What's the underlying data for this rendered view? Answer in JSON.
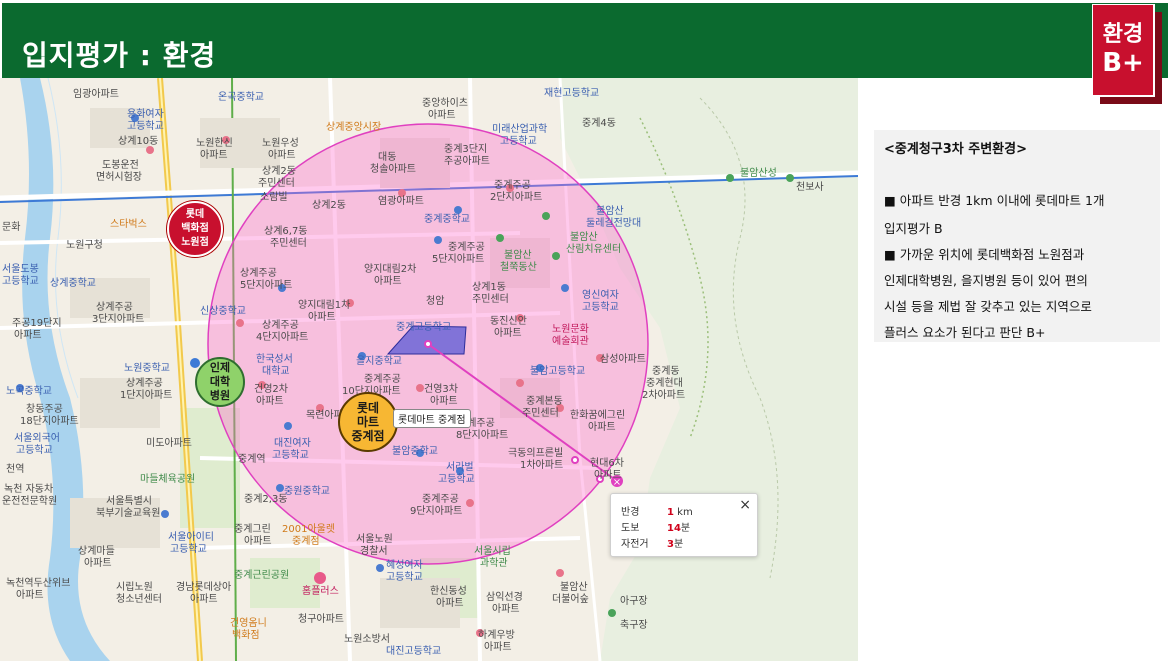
{
  "header": {
    "title": "입지평가 : 환경",
    "grade_word": "환경",
    "grade_value": "B+"
  },
  "colors": {
    "header_green": "#0b6a2f",
    "grade_red": "#c8102e",
    "radius_fill": "#ff66cc",
    "route_line": "#e040c0"
  },
  "map": {
    "badges": {
      "lotte_dept": [
        "롯데",
        "백화점",
        "노원점"
      ],
      "inje": [
        "인제",
        "대학",
        "병원"
      ],
      "lotte_mart": [
        "롯데",
        "마트",
        "중계점"
      ]
    },
    "tooltip": "롯데마트 중계점",
    "labels": {
      "l01": "임광아파트",
      "l02": "용화여자",
      "l03": "고등학교",
      "l04": "도봉운전",
      "l05": "면허시험장",
      "l06": "노원구청",
      "l07": "스타벅스",
      "l08": "상계주공",
      "l09": "3단지아파트",
      "l10": "주공19단지",
      "l11": "아파트",
      "l12": "노원중학교",
      "l13": "상계주공",
      "l14": "1단지아파트",
      "l15": "창동주공",
      "l16": "18단지아파트",
      "l17": "서울외국어",
      "l18": "고등학교",
      "l19": "미도아파트",
      "l20": "마들체육공원",
      "l21": "서울특별시",
      "l22": "북부기술교육원",
      "l23": "서울아이티",
      "l24": "고등학교",
      "l25": "상계마들",
      "l26": "아파트",
      "l27": "녹천역두산위브",
      "l28": "아파트",
      "l29": "시립노원",
      "l30": "청소년센터",
      "l31": "경남롯데상아",
      "l32": "아파트",
      "l33": "건영옴니",
      "l34": "백화점",
      "l35": "청구아파트",
      "l36": "노원소방서",
      "l37": "중계역",
      "l38": "중계그린",
      "l39": "아파트",
      "l40": "2001아울렛",
      "l41": "중계점",
      "l42": "중계근린공원",
      "l43": "홈플러스",
      "l44": "서울노원",
      "l45": "경찰서",
      "l46": "혜성여자",
      "l47": "고등학교",
      "l48": "한신동성",
      "l49": "아파트",
      "l50": "삼익선경",
      "l51": "아파트",
      "l52": "하계우방",
      "l53": "아파트",
      "l54": "대진고등학교",
      "l55": "중계주공",
      "l56": "9단지아파트",
      "l57": "서라벌",
      "l58": "고등학교",
      "l59": "불암중학교",
      "l60": "극동의프른빌",
      "l61": "1차아파트",
      "l62": "현대6차",
      "l63": "아파트",
      "l64": "서울시립",
      "l65": "과학관",
      "l66": "불암산",
      "l67": "더불어숲",
      "l68": "아구장",
      "l69": "축구장",
      "l70": "중계본동",
      "l71": "주민센터",
      "l72": "한화꿈에그린",
      "l73": "아파트",
      "l74": "중계주공",
      "l75": "8단지아파트",
      "l76": "건영3차",
      "l77": "아파트",
      "l78": "중계주공",
      "l79": "10단지아파트",
      "l80": "목련아파트",
      "l81": "대진여자",
      "l82": "고등학교",
      "l83": "중원중학교",
      "l84": "건영2차",
      "l85": "아파트",
      "l86": "한국성서",
      "l87": "대학교",
      "l88": "상계주공",
      "l89": "4단지아파트",
      "l90": "을지중학교",
      "l91": "중계고등학교",
      "l92": "청암",
      "l93": "동진신안",
      "l94": "아파트",
      "l95": "노원문화",
      "l96": "예술회관",
      "l97": "삼성아파트",
      "l98": "중계동",
      "l99": "중계현대",
      "l100": "2차아파트",
      "l101": "불암고등학교",
      "l102": "영신여자",
      "l103": "고등학교",
      "l104": "상계1동",
      "l105": "주민센터",
      "l106": "불암산",
      "l107": "철쭉동산",
      "l108": "중계주공",
      "l109": "5단지아파트",
      "l110": "양지대림2차",
      "l111": "아파트",
      "l112": "양지대림1차",
      "l113": "아파트",
      "l114": "상계주공",
      "l115": "5단지아파트",
      "l116": "신상중학교",
      "l117": "상계6,7동",
      "l118": "주민센터",
      "l119": "상계2동",
      "l120": "중계중학교",
      "l121": "염광아파트",
      "l122": "중계주공",
      "l123": "2단지아파트",
      "l124": "불암산",
      "l125": "산림치유센터",
      "l126": "불암산",
      "l127": "둘레길전망대",
      "l128": "불암산성",
      "l129": "천보사",
      "l130": "중계4동",
      "l131": "재현고등학교",
      "l132": "미래산업과학",
      "l133": "고등학교",
      "l134": "중계3단지",
      "l135": "주공아파트",
      "l136": "대동",
      "l137": "청솔아파트",
      "l138": "중앙하이츠",
      "l139": "아파트",
      "l140": "상계중앙시장",
      "l141": "노원우성",
      "l142": "아파트",
      "l143": "상계2동",
      "l144": "주민센터",
      "l145": "소람빌",
      "l146": "노원한신",
      "l147": "아파트",
      "l148": "온곡중학교",
      "l149": "상계10동",
      "l150": "문화",
      "l151": "서울도봉",
      "l152": "고등학교",
      "l153": "노곡중학교",
      "l154": "천역",
      "l155": "녹천 자동차",
      "l156": "운전전문학원",
      "l157": "상계중학교",
      "l158": "중계2,3동"
    },
    "distance_card": {
      "radius_label": "반경",
      "radius_value": "1",
      "radius_unit": "km",
      "walk_label": "도보",
      "walk_value": "14",
      "walk_unit": "분",
      "bike_label": "자전거",
      "bike_value": "3",
      "bike_unit": "분",
      "close_icon": "×"
    }
  },
  "info": {
    "title": "<중계청구3차 주변환경>",
    "line1": "■ 아파트 반경 1km 이내에 롯데마트 1개",
    "line2": "입지평가 B",
    "line3": "■ 가까운 위치에 롯데백화점 노원점과",
    "line4": "인제대학병원, 을지병원 등이 있어 편의",
    "line5": "시설 등을 제법 잘 갖추고 있는 지역으로",
    "line6": "플러스 요소가 된다고 판단 B+"
  }
}
